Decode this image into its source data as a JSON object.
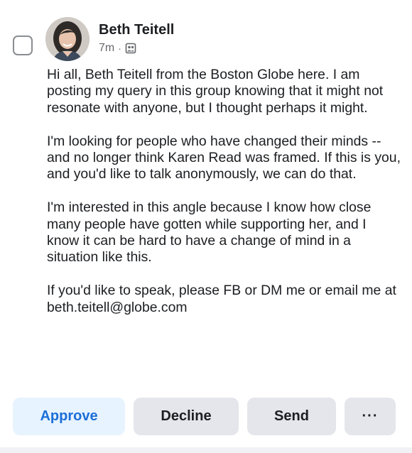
{
  "post": {
    "author": "Beth Teitell",
    "time": "7m",
    "separator": "·",
    "audience_icon": "group-icon",
    "paragraphs": [
      "Hi all, Beth Teitell from the Boston Globe here. I am posting my query in this group knowing that it might not resonate with anyone, but I thought perhaps it might.",
      "I'm looking for people who have changed their minds -- and no longer think Karen Read was framed. If this is you, and you'd like to talk anonymously, we can do that.",
      "I'm interested in this angle because I know how close many people have gotten while supporting her, and I know it can be hard to have a change of mind in a situation like this.",
      "If you'd like to speak, please FB or DM me or email me at beth.teitell@globe.com"
    ]
  },
  "actions": {
    "approve": "Approve",
    "decline": "Decline",
    "send": "Send",
    "more": "···"
  },
  "colors": {
    "approve_bg": "#e7f3ff",
    "approve_text": "#1b6fd8",
    "button_bg": "#e4e6eb",
    "meta_text": "#65676b"
  }
}
